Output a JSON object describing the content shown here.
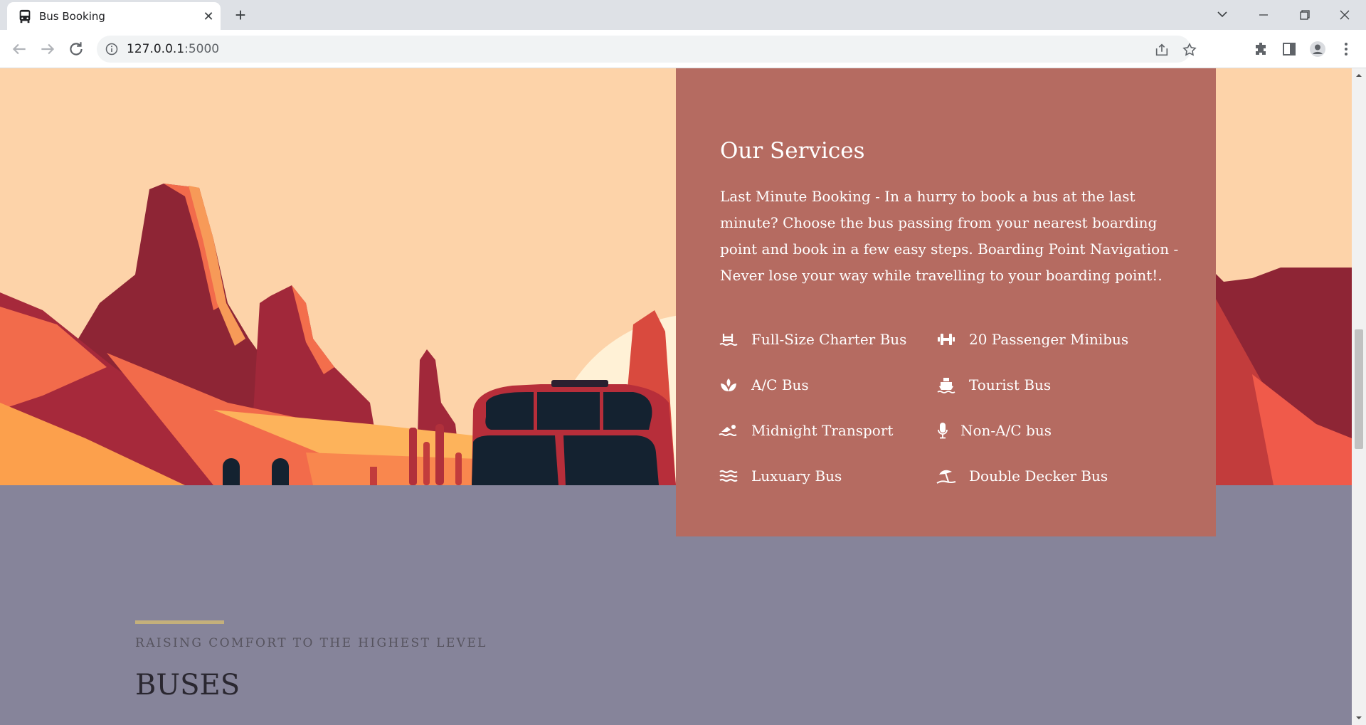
{
  "browser": {
    "tab_title": "Bus Booking",
    "url_host": "127.0.0.1",
    "url_port": ":5000"
  },
  "services": {
    "title": "Our Services",
    "description": "Last Minute Booking - In a hurry to book a bus at the last minute? Choose the bus passing from your nearest boarding point and book in a few easy steps. Boarding Point Navigation - Never lose your way while travelling to your boarding point!.",
    "items": [
      {
        "label": "Full-Size Charter Bus",
        "icon": "pool-icon"
      },
      {
        "label": "20 Passenger Minibus",
        "icon": "dumbbell-icon"
      },
      {
        "label": "A/C Bus",
        "icon": "spa-icon"
      },
      {
        "label": "Tourist Bus",
        "icon": "ship-icon"
      },
      {
        "label": "Midnight Transport",
        "icon": "swimmer-icon"
      },
      {
        "label": "Non-A/C bus",
        "icon": "microphone-icon"
      },
      {
        "label": "Luxuary Bus",
        "icon": "water-icon"
      },
      {
        "label": "Double Decker Bus",
        "icon": "umbrella-beach-icon"
      }
    ]
  },
  "section": {
    "kicker": "RAISING COMFORT TO THE HIGHEST LEVEL",
    "heading": "BUSES"
  },
  "colors": {
    "services_panel": "#b56b61",
    "hero_sky": "#fdd3a9",
    "section_bg": "#86849a",
    "accent_rule": "#c4b07b"
  }
}
